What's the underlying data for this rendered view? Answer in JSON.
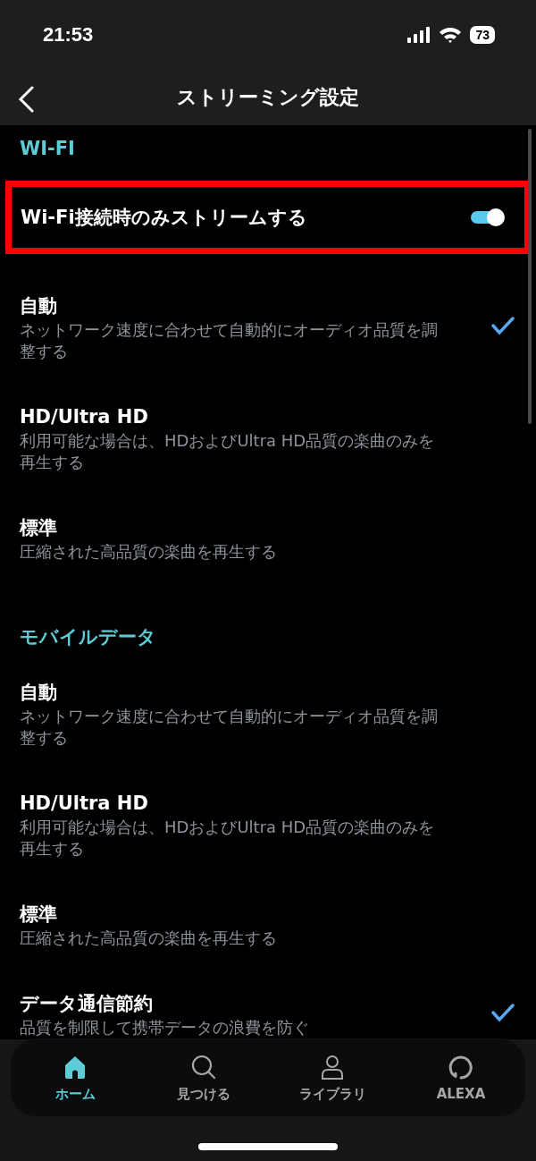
{
  "status_bar": {
    "time": "21:53",
    "battery": "73"
  },
  "header": {
    "title": "ストリーミング設定"
  },
  "sections": [
    {
      "title": "WI-FI",
      "toggle": {
        "label": "Wi-Fi接続時のみストリームする",
        "on": true,
        "highlighted": true
      },
      "options": [
        {
          "title": "自動",
          "subtitle": "ネットワーク速度に合わせて自動的にオーディオ品質を調整する",
          "selected": true
        },
        {
          "title": "HD/Ultra HD",
          "subtitle": "利用可能な場合は、HDおよびUltra HD品質の楽曲のみを再生する",
          "selected": false
        },
        {
          "title": "標準",
          "subtitle": "圧縮された高品質の楽曲を再生する",
          "selected": false
        }
      ]
    },
    {
      "title": "モバイルデータ",
      "options": [
        {
          "title": "自動",
          "subtitle": "ネットワーク速度に合わせて自動的にオーディオ品質を調整する",
          "selected": false
        },
        {
          "title": "HD/Ultra HD",
          "subtitle": "利用可能な場合は、HDおよびUltra HD品質の楽曲のみを再生する",
          "selected": false
        },
        {
          "title": "標準",
          "subtitle": "圧縮された高品質の楽曲を再生する",
          "selected": false
        },
        {
          "title": "データ通信節約",
          "subtitle": "品質を制限して携帯データの浪費を防ぐ",
          "selected": true
        }
      ]
    }
  ],
  "nav": [
    {
      "label": "ホーム",
      "kind": "home",
      "selected": true
    },
    {
      "label": "見つける",
      "kind": "search",
      "selected": false
    },
    {
      "label": "ライブラリ",
      "kind": "person",
      "selected": false
    },
    {
      "label": "ALEXA",
      "kind": "ring",
      "selected": false
    }
  ]
}
